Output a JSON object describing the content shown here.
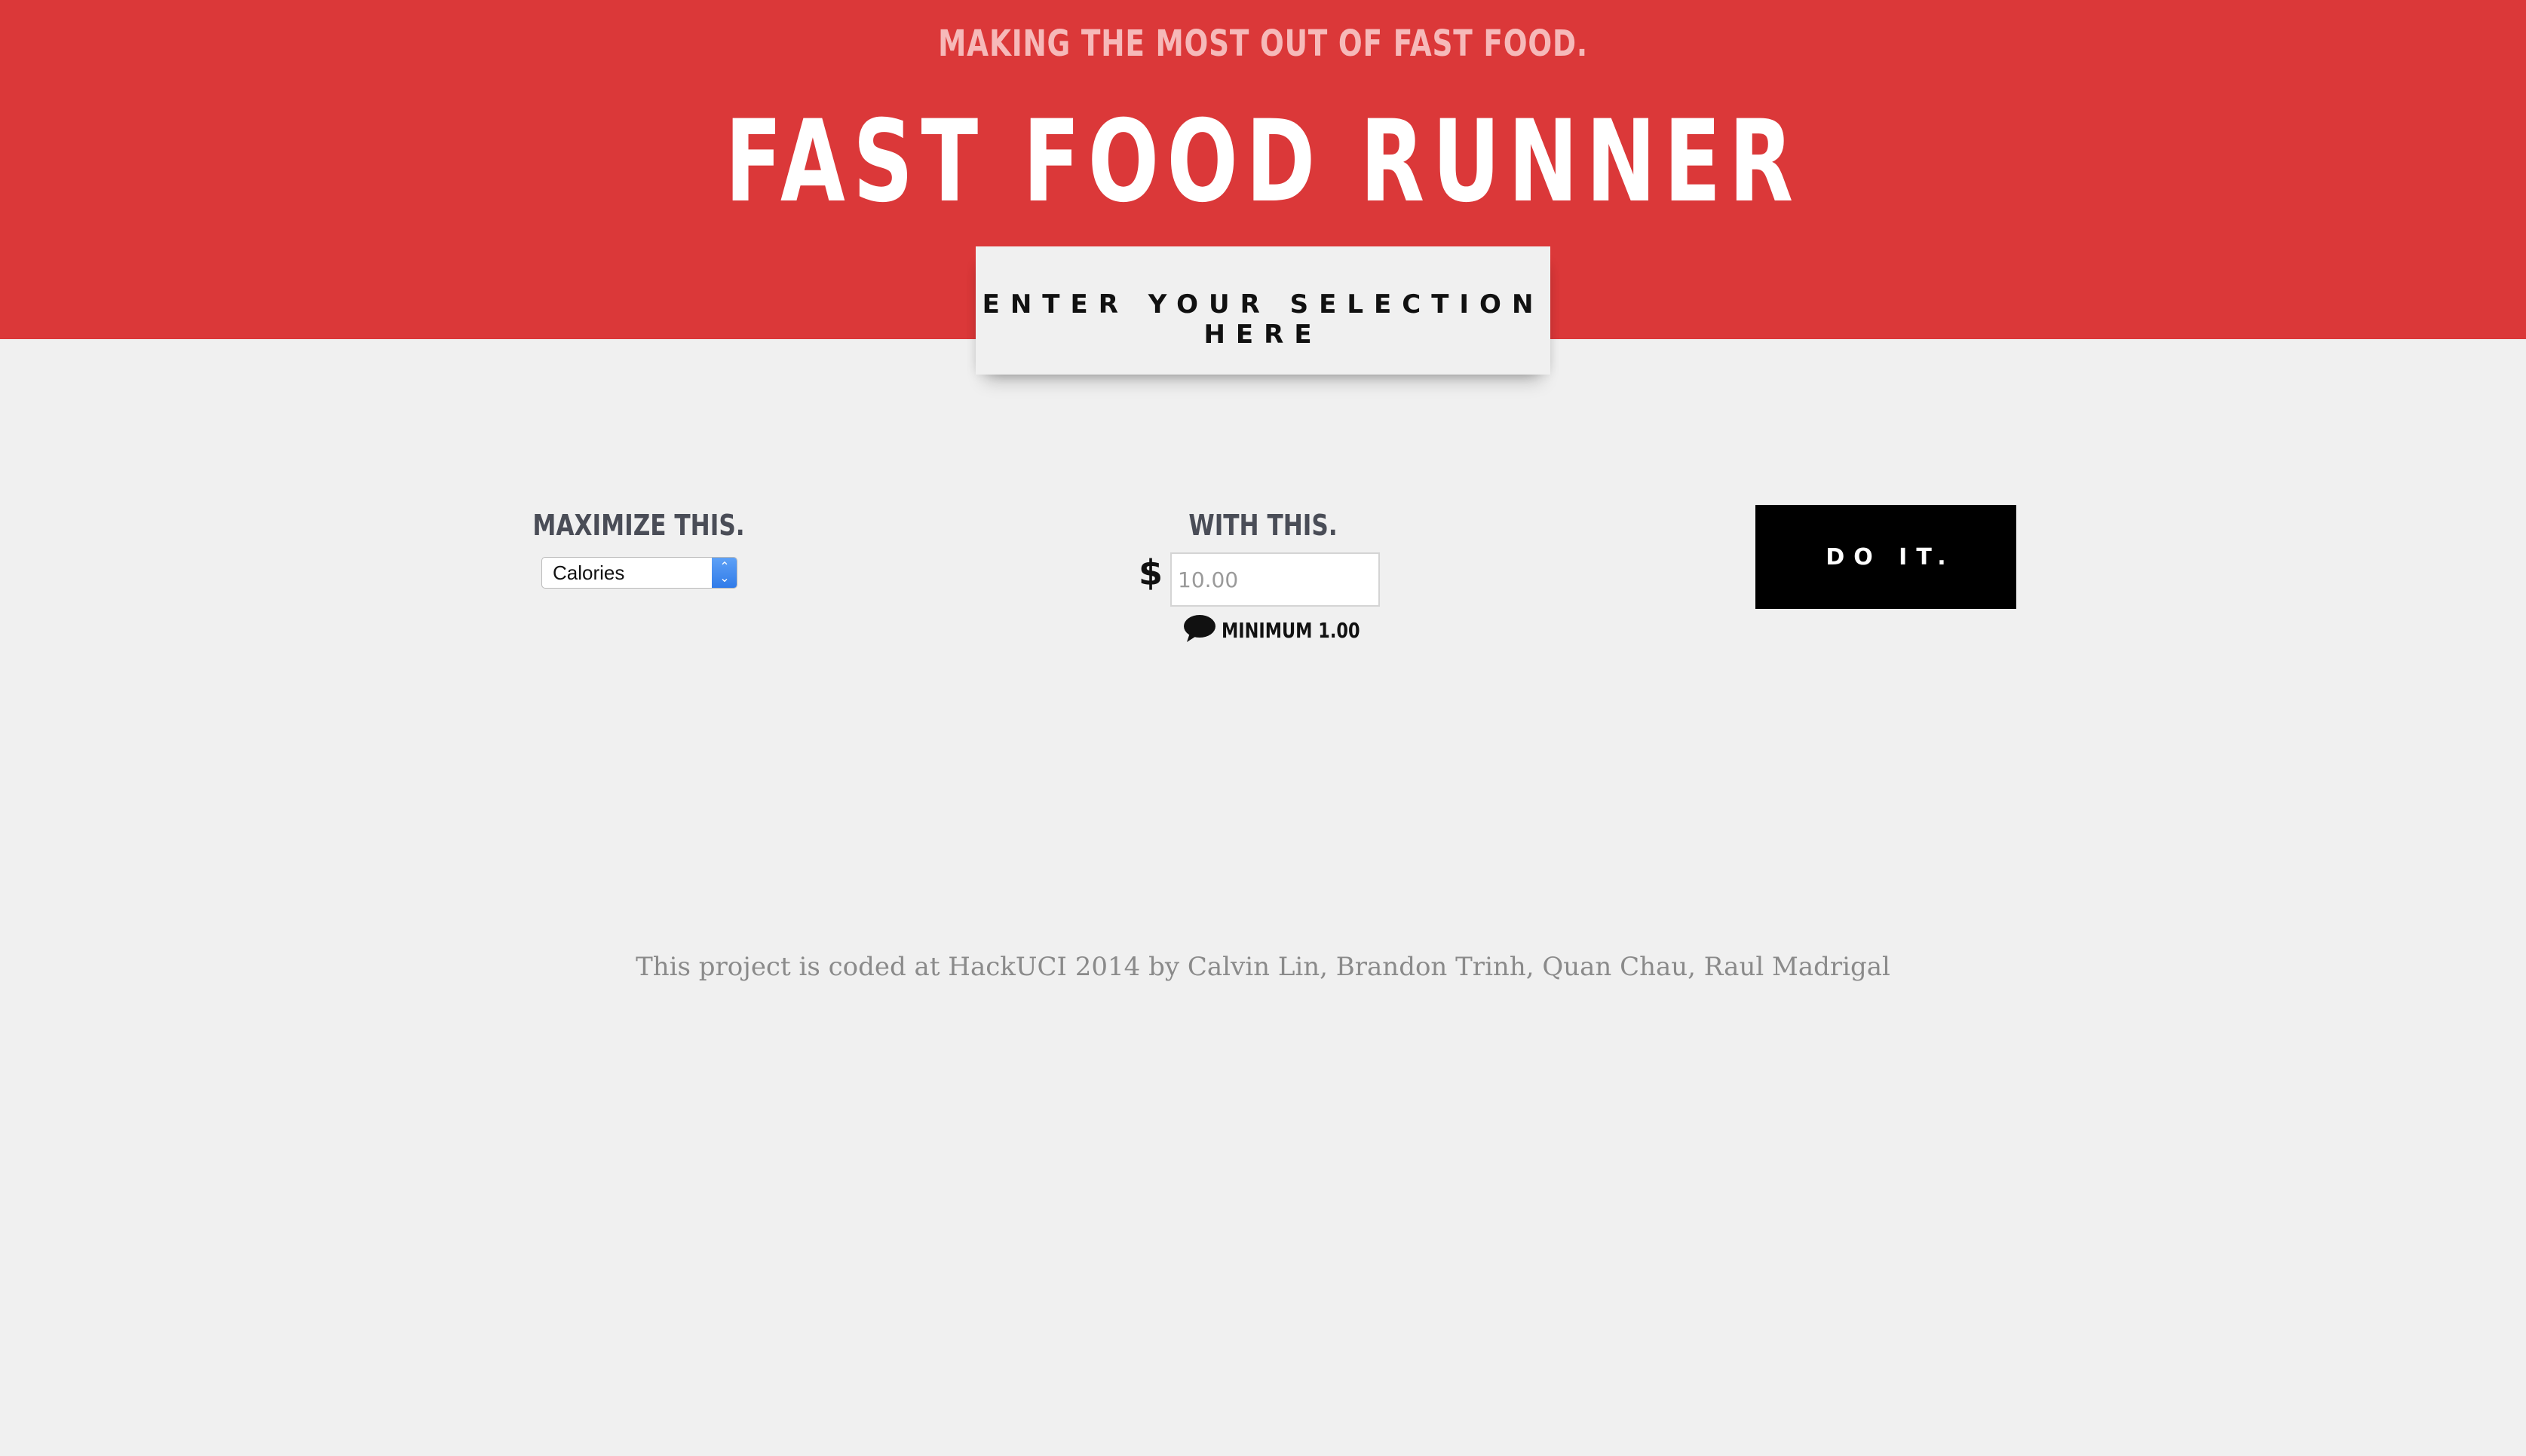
{
  "header": {
    "tagline": "MAKING THE MOST OUT OF FAST FOOD.",
    "title": "FAST FOOD RUNNER",
    "selection_prompt": "ENTER YOUR SELECTION HERE"
  },
  "form": {
    "maximize": {
      "label": "MAXIMIZE THIS.",
      "selected": "Calories"
    },
    "budget": {
      "label": "WITH THIS.",
      "currency_symbol": "$",
      "placeholder": "10.00",
      "hint": "MINIMUM 1.00"
    },
    "submit_label": "DO IT."
  },
  "footer": {
    "credits": "This project is coded at HackUCI 2014 by Calvin Lin, Brandon Trinh, Quan Chau, Raul Madrigal"
  },
  "colors": {
    "header_red": "#db3839",
    "background": "#f0f0f0",
    "button": "#000000"
  },
  "icons": {
    "hint": "speech-bubble-icon",
    "select": "chevron-up-down-icon"
  }
}
